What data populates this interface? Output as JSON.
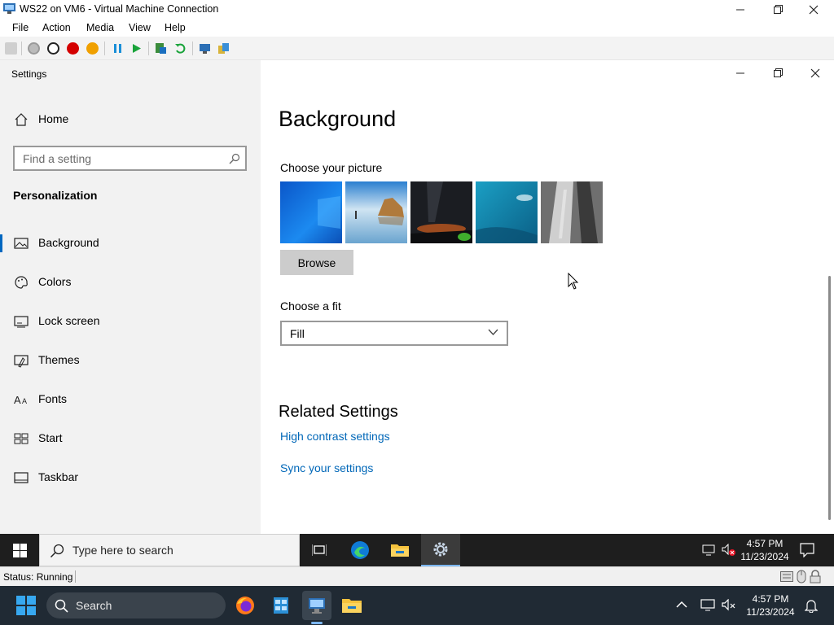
{
  "vm_window": {
    "title": "WS22 on VM6 - Virtual Machine Connection",
    "menu": [
      "File",
      "Action",
      "Media",
      "View",
      "Help"
    ],
    "status": "Status: Running"
  },
  "settings": {
    "app_title": "Settings",
    "home_label": "Home",
    "search_placeholder": "Find a setting",
    "section": "Personalization",
    "nav_items": [
      {
        "label": "Background",
        "icon": "picture-icon"
      },
      {
        "label": "Colors",
        "icon": "palette-icon"
      },
      {
        "label": "Lock screen",
        "icon": "lock-screen-icon"
      },
      {
        "label": "Themes",
        "icon": "themes-icon"
      },
      {
        "label": "Fonts",
        "icon": "fonts-icon"
      },
      {
        "label": "Start",
        "icon": "start-icon"
      },
      {
        "label": "Taskbar",
        "icon": "taskbar-icon"
      }
    ],
    "active_item": "Background",
    "page_title": "Background",
    "choose_picture_label": "Choose your picture",
    "browse_label": "Browse",
    "choose_fit_label": "Choose a fit",
    "fit_value": "Fill",
    "related_heading": "Related Settings",
    "links": [
      "High contrast settings",
      "Sync your settings"
    ]
  },
  "guest_taskbar": {
    "search_placeholder": "Type here to search",
    "time": "4:57 PM",
    "date": "11/23/2024"
  },
  "host_taskbar": {
    "search_label": "Search",
    "time": "4:57 PM",
    "date": "11/23/2024"
  },
  "colors": {
    "accent": "#0067c0",
    "link": "#0067b8",
    "guest_taskbar": "#1e1e1e",
    "host_taskbar": "#202a34"
  }
}
